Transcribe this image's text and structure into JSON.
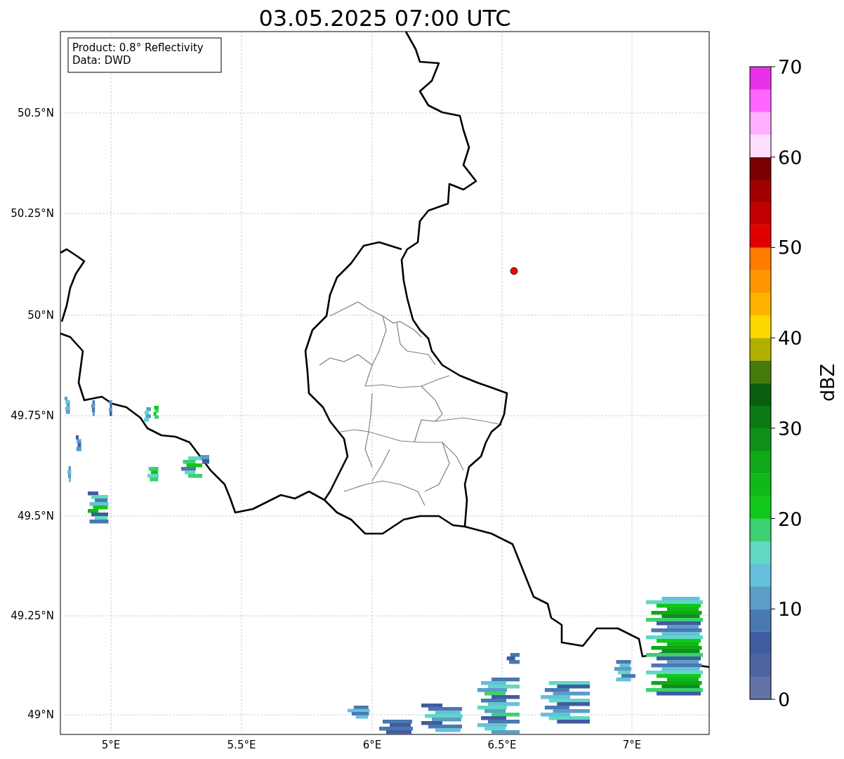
{
  "title": "03.05.2025 07:00 UTC",
  "info_box": [
    "Product: 0.8° Reflectivity",
    "Data: DWD"
  ],
  "map": {
    "y_axis_labels": [
      "50.5°N",
      "50.25°N",
      "50°N",
      "49.75°N",
      "49.5°N",
      "49.25°N",
      "49°N"
    ],
    "x_axis_labels": [
      "5°E",
      "5.5°E",
      "6°E",
      "6.5°E",
      "7°E"
    ]
  },
  "colorbar": {
    "label": "dBZ",
    "ticks": [
      "70",
      "60",
      "50",
      "40",
      "30",
      "20",
      "10",
      "0"
    ],
    "bins": [
      {
        "color": "#6373a7"
      },
      {
        "color": "#5064a0"
      },
      {
        "color": "#405ca0"
      },
      {
        "color": "#4a78b0"
      },
      {
        "color": "#5a9ec8"
      },
      {
        "color": "#66c0dc"
      },
      {
        "color": "#60d8c4"
      },
      {
        "color": "#3cd070"
      },
      {
        "color": "#10c81a"
      },
      {
        "color": "#10b818"
      },
      {
        "color": "#10a818"
      },
      {
        "color": "#0e9018"
      },
      {
        "color": "#0c7a12"
      },
      {
        "color": "#0a5e10"
      },
      {
        "color": "#467a0a"
      },
      {
        "color": "#b0b000"
      },
      {
        "color": "#ffd700"
      },
      {
        "color": "#ffb300"
      },
      {
        "color": "#ff9800"
      },
      {
        "color": "#ff7c00"
      },
      {
        "color": "#e00000"
      },
      {
        "color": "#c00000"
      },
      {
        "color": "#a00000"
      },
      {
        "color": "#780000"
      },
      {
        "color": "#ffe0ff"
      },
      {
        "color": "#ffb0ff"
      },
      {
        "color": "#ff66ff"
      },
      {
        "color": "#e830e8"
      }
    ]
  }
}
